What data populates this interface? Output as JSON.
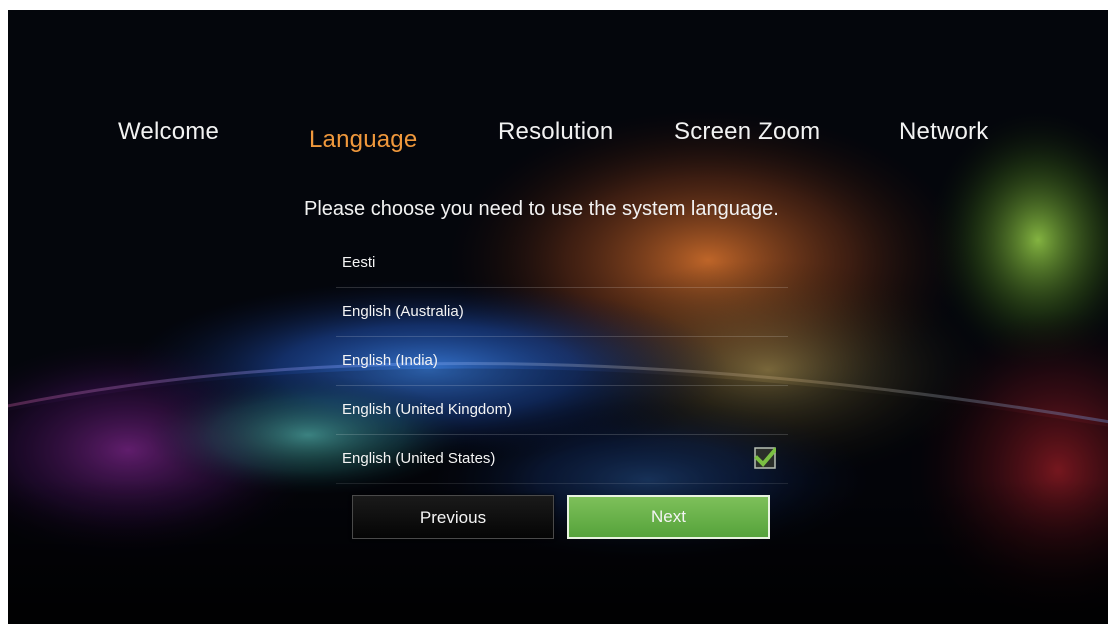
{
  "wizard": {
    "steps": [
      {
        "label": "Welcome",
        "state": "default"
      },
      {
        "label": "Language",
        "state": "active"
      },
      {
        "label": "Resolution",
        "state": "default"
      },
      {
        "label": "Screen Zoom",
        "state": "default"
      },
      {
        "label": "Network",
        "state": "default"
      }
    ],
    "active_color": "#f0983c"
  },
  "language_page": {
    "prompt": "Please choose you need to use the system language.",
    "languages": [
      {
        "label": "Eesti",
        "selected": false
      },
      {
        "label": "English (Australia)",
        "selected": false
      },
      {
        "label": "English (India)",
        "selected": false
      },
      {
        "label": "English (United Kingdom)",
        "selected": false
      },
      {
        "label": "English (United States)",
        "selected": true
      }
    ],
    "check_icon": "checkmark-icon",
    "check_color": "#7bc043"
  },
  "buttons": {
    "previous_label": "Previous",
    "next_label": "Next",
    "next_color": "#6cb24a"
  }
}
